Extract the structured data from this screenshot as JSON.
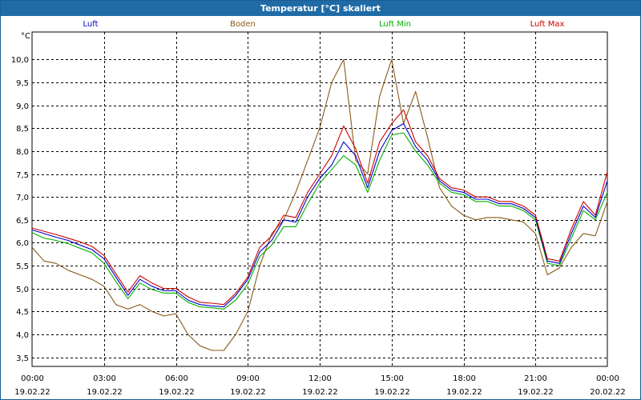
{
  "chart_data": {
    "type": "line",
    "title": "Temperatur [°C] skaliert",
    "ylabel": "°C",
    "ylim": [
      3.3,
      10.6
    ],
    "yticks": [
      {
        "value": 3.5,
        "label": "3,5"
      },
      {
        "value": 4.0,
        "label": "4,0"
      },
      {
        "value": 4.5,
        "label": "4,5"
      },
      {
        "value": 5.0,
        "label": "5,0"
      },
      {
        "value": 5.5,
        "label": "5,5"
      },
      {
        "value": 6.0,
        "label": "6,0"
      },
      {
        "value": 6.5,
        "label": "6,5"
      },
      {
        "value": 7.0,
        "label": "7,0"
      },
      {
        "value": 7.5,
        "label": "7,5"
      },
      {
        "value": 8.0,
        "label": "8,0"
      },
      {
        "value": 8.5,
        "label": "8,5"
      },
      {
        "value": 9.0,
        "label": "9,0"
      },
      {
        "value": 9.5,
        "label": "9,5"
      },
      {
        "value": 10.0,
        "label": "10,0"
      }
    ],
    "xlim": [
      "19.02.22 00:00",
      "20.02.22 00:00"
    ],
    "xticks": [
      {
        "value": "19.02.22 00:00",
        "time": "00:00",
        "date": "19.02.22"
      },
      {
        "value": "19.02.22 03:00",
        "time": "03:00",
        "date": "19.02.22"
      },
      {
        "value": "19.02.22 06:00",
        "time": "06:00",
        "date": "19.02.22"
      },
      {
        "value": "19.02.22 09:00",
        "time": "09:00",
        "date": "19.02.22"
      },
      {
        "value": "19.02.22 12:00",
        "time": "12:00",
        "date": "19.02.22"
      },
      {
        "value": "19.02.22 15:00",
        "time": "15:00",
        "date": "19.02.22"
      },
      {
        "value": "19.02.22 18:00",
        "time": "18:00",
        "date": "19.02.22"
      },
      {
        "value": "19.02.22 21:00",
        "time": "21:00",
        "date": "19.02.22"
      },
      {
        "value": "20.02.22 00:00",
        "time": "00:00",
        "date": "20.02.22"
      }
    ],
    "grid": true,
    "legend_position": "top",
    "x": [
      "19.02.22 00:00",
      "19.02.22 00:30",
      "19.02.22 01:00",
      "19.02.22 01:30",
      "19.02.22 02:00",
      "19.02.22 02:30",
      "19.02.22 03:00",
      "19.02.22 03:30",
      "19.02.22 04:00",
      "19.02.22 04:30",
      "19.02.22 05:00",
      "19.02.22 05:30",
      "19.02.22 06:00",
      "19.02.22 06:30",
      "19.02.22 07:00",
      "19.02.22 07:30",
      "19.02.22 08:00",
      "19.02.22 08:30",
      "19.02.22 09:00",
      "19.02.22 09:30",
      "19.02.22 10:00",
      "19.02.22 10:30",
      "19.02.22 11:00",
      "19.02.22 11:30",
      "19.02.22 12:00",
      "19.02.22 12:30",
      "19.02.22 13:00",
      "19.02.22 13:30",
      "19.02.22 14:00",
      "19.02.22 14:30",
      "19.02.22 15:00",
      "19.02.22 15:30",
      "19.02.22 16:00",
      "19.02.22 16:30",
      "19.02.22 17:00",
      "19.02.22 17:30",
      "19.02.22 18:00",
      "19.02.22 18:30",
      "19.02.22 19:00",
      "19.02.22 19:30",
      "19.02.22 20:00",
      "19.02.22 20:30",
      "19.02.22 21:00",
      "19.02.22 21:30",
      "19.02.22 22:00",
      "19.02.22 22:30",
      "19.02.22 23:00",
      "19.02.22 23:30",
      "20.02.22 00:00"
    ],
    "series": [
      {
        "name": "Luft",
        "color": "#0000cc",
        "values": [
          6.28,
          6.2,
          6.12,
          6.05,
          5.95,
          5.85,
          5.65,
          5.25,
          4.85,
          5.2,
          5.05,
          4.95,
          4.95,
          4.75,
          4.65,
          4.62,
          4.6,
          4.85,
          5.2,
          5.8,
          6.05,
          6.5,
          6.45,
          7.0,
          7.4,
          7.7,
          8.2,
          7.9,
          7.2,
          8.0,
          8.45,
          8.6,
          8.1,
          7.8,
          7.35,
          7.15,
          7.1,
          6.95,
          6.95,
          6.85,
          6.85,
          6.75,
          6.55,
          5.6,
          5.55,
          6.2,
          6.8,
          6.55,
          7.35
        ]
      },
      {
        "name": "Boden",
        "color": "#8a5a1a",
        "values": [
          5.9,
          5.6,
          5.55,
          5.4,
          5.3,
          5.2,
          5.05,
          4.65,
          4.55,
          4.65,
          4.5,
          4.4,
          4.45,
          4.0,
          3.75,
          3.65,
          3.65,
          4.0,
          4.5,
          5.5,
          6.2,
          6.5,
          7.1,
          7.8,
          8.5,
          9.5,
          10.0,
          7.8,
          7.5,
          9.2,
          10.0,
          8.6,
          9.3,
          8.3,
          7.2,
          6.8,
          6.6,
          6.5,
          6.55,
          6.55,
          6.5,
          6.45,
          6.2,
          5.3,
          5.45,
          5.9,
          6.2,
          6.15,
          6.9
        ]
      },
      {
        "name": "Luft Min",
        "color": "#00b000",
        "values": [
          6.22,
          6.1,
          6.05,
          5.98,
          5.88,
          5.78,
          5.55,
          5.15,
          4.78,
          5.12,
          4.98,
          4.9,
          4.9,
          4.7,
          4.6,
          4.58,
          4.55,
          4.75,
          5.1,
          5.7,
          5.95,
          6.35,
          6.35,
          6.85,
          7.3,
          7.6,
          7.9,
          7.7,
          7.1,
          7.8,
          8.35,
          8.4,
          8.0,
          7.7,
          7.3,
          7.1,
          7.05,
          6.9,
          6.9,
          6.8,
          6.8,
          6.7,
          6.5,
          5.55,
          5.5,
          6.1,
          6.7,
          6.5,
          7.1
        ]
      },
      {
        "name": "Luft Max",
        "color": "#cc0000",
        "values": [
          6.32,
          6.25,
          6.18,
          6.1,
          6.02,
          5.92,
          5.72,
          5.32,
          4.92,
          5.28,
          5.12,
          5.0,
          5.0,
          4.82,
          4.7,
          4.68,
          4.65,
          4.9,
          5.25,
          5.9,
          6.15,
          6.6,
          6.55,
          7.1,
          7.5,
          7.9,
          8.55,
          8.05,
          7.3,
          8.2,
          8.6,
          8.9,
          8.2,
          7.9,
          7.4,
          7.2,
          7.15,
          7.0,
          7.0,
          6.9,
          6.9,
          6.8,
          6.6,
          5.65,
          5.6,
          6.3,
          6.9,
          6.6,
          7.55
        ]
      }
    ]
  }
}
